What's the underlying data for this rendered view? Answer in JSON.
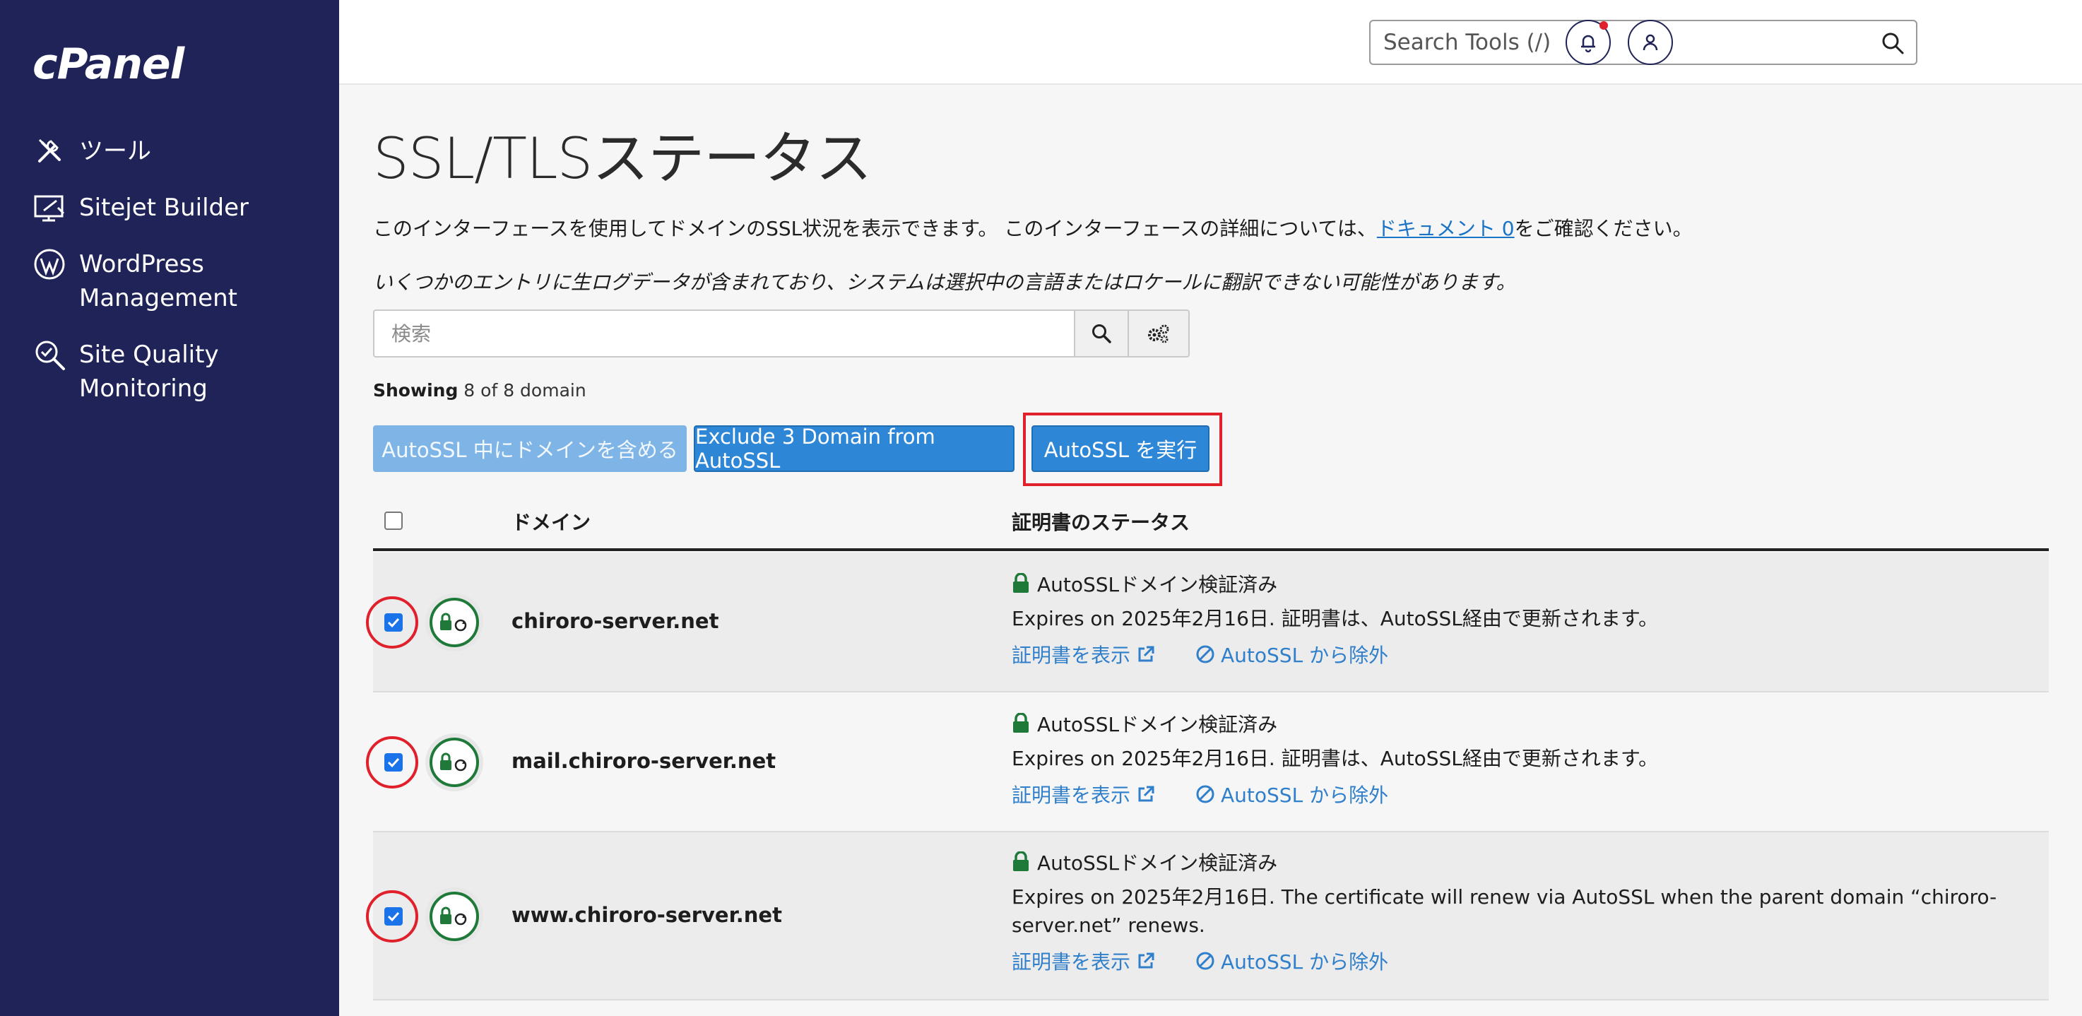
{
  "app": {
    "logo": "cPanel"
  },
  "sidebar": {
    "items": [
      {
        "label": "ツール",
        "icon": "tools-icon"
      },
      {
        "label": "Sitejet Builder",
        "icon": "sitejet-icon"
      },
      {
        "label": "WordPress\nManagement",
        "icon": "wordpress-icon"
      },
      {
        "label": "Site Quality\nMonitoring",
        "icon": "site-quality-icon"
      }
    ]
  },
  "header": {
    "search_placeholder": "Search Tools (/)"
  },
  "page": {
    "title": "SSL/TLSステータス",
    "description_prefix": "このインターフェースを使用してドメインのSSL状況を表示できます。 このインターフェースの詳細については、",
    "doc_link": "ドキュメント 0",
    "description_suffix": "をご確認ください。",
    "notice": "いくつかのエントリに生ログデータが含まれており、システムは選択中の言語またはロケールに翻訳できない可能性があります。",
    "filter_placeholder": "検索",
    "showing_label": "Showing",
    "showing_text": "8 of 8 domain"
  },
  "actions": {
    "include": "AutoSSL 中にドメインを含める",
    "exclude": "Exclude 3 Domain from AutoSSL",
    "run": "AutoSSL を実行"
  },
  "table": {
    "col_domain": "ドメイン",
    "col_status": "証明書のステータス",
    "rows": [
      {
        "domain": "chiroro-server.net",
        "status": "AutoSSLドメイン検証済み",
        "expires": "Expires on 2025年2月16日. 証明書は、AutoSSL経由で更新されます。",
        "view_cert": "証明書を表示",
        "exclude": "AutoSSL から除外",
        "checked": true
      },
      {
        "domain": "mail.chiroro-server.net",
        "status": "AutoSSLドメイン検証済み",
        "expires": "Expires on 2025年2月16日. 証明書は、AutoSSL経由で更新されます。",
        "view_cert": "証明書を表示",
        "exclude": "AutoSSL から除外",
        "checked": true
      },
      {
        "domain": "www.chiroro-server.net",
        "status": "AutoSSLドメイン検証済み",
        "expires": "Expires on 2025年2月16日. The certificate will renew via AutoSSL when the parent domain “chiroro-server.net” renews.",
        "view_cert": "証明書を表示",
        "exclude": "AutoSSL から除外",
        "checked": true
      }
    ]
  },
  "colors": {
    "sidebar": "#1f2357",
    "primary_button": "#2e86d6",
    "highlight": "#e0202b",
    "valid_green": "#1f7a3a",
    "link": "#2f7fcb"
  }
}
